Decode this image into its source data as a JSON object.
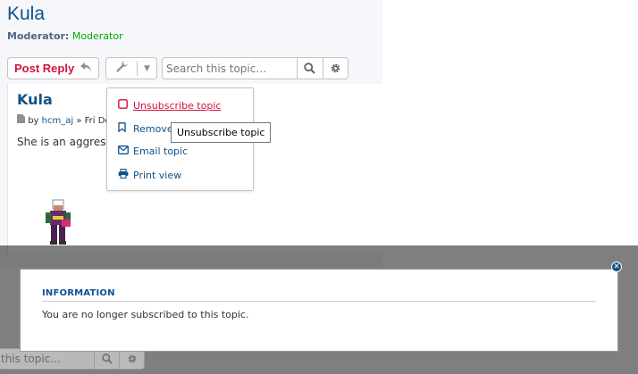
{
  "topic": {
    "title": "Kula",
    "moderator_label": "Moderator:",
    "moderator_value": "Moderator"
  },
  "actions": {
    "post_reply_label": "Post Reply",
    "search_placeholder": "Search this topic…"
  },
  "post": {
    "title": "Kula",
    "by_label": "by",
    "author": "hcm_aj",
    "date_fragment": "» Fri Dec",
    "body_fragment": "She is an aggress"
  },
  "tools_menu": {
    "items": [
      {
        "label": "Unsubscribe topic",
        "icon": "checkbox-icon"
      },
      {
        "label": "Remove",
        "icon": "bookmark-icon"
      },
      {
        "label": "Email topic",
        "icon": "envelope-icon"
      },
      {
        "label": "Print view",
        "icon": "printer-icon"
      }
    ]
  },
  "tooltip": {
    "text": "Unsubscribe topic"
  },
  "overlay": {
    "search_fragment": "this topic..."
  },
  "alert": {
    "title": "INFORMATION",
    "message": "You are no longer subscribed to this topic."
  },
  "colors": {
    "link": "#105289",
    "accent_red": "#d31141",
    "moderator_green": "#00aa00"
  }
}
